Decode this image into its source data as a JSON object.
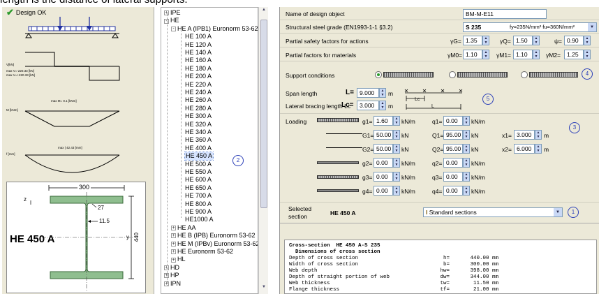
{
  "top_text": "length is the distance of lateral supports.",
  "left": {
    "status": "Design OK",
    "shear_labels": [
      "V[kN]",
      "max V=-220.33 [kN]",
      "max V=+220.33 [kN]"
    ],
    "moment_label": "max M= 0.1 [kNm]",
    "moment2_label": "M [kNm]",
    "deflection_label": "max | 42.43 [mm]",
    "deflection_axis": "f [mm]",
    "section": {
      "name": "HE 450 A",
      "width": "300",
      "height": "440",
      "flange": "27",
      "web": "11.5",
      "axis_z": "z",
      "axis_y": "y"
    }
  },
  "tree": {
    "items": [
      {
        "label": "IPE",
        "level": 0,
        "exp": "+"
      },
      {
        "label": "HE",
        "level": 0,
        "exp": "-"
      },
      {
        "label": "HE A (IPB1) Euronorm 53-62",
        "level": 1,
        "exp": "-"
      },
      {
        "label": "HE 100 A",
        "level": 2
      },
      {
        "label": "HE 120 A",
        "level": 2
      },
      {
        "label": "HE 140 A",
        "level": 2
      },
      {
        "label": "HE 160 A",
        "level": 2
      },
      {
        "label": "HE 180 A",
        "level": 2
      },
      {
        "label": "HE 200 A",
        "level": 2
      },
      {
        "label": "HE 220 A",
        "level": 2
      },
      {
        "label": "HE 240 A",
        "level": 2
      },
      {
        "label": "HE 260 A",
        "level": 2
      },
      {
        "label": "HE 280 A",
        "level": 2
      },
      {
        "label": "HE 300 A",
        "level": 2
      },
      {
        "label": "HE 320 A",
        "level": 2
      },
      {
        "label": "HE 340 A",
        "level": 2
      },
      {
        "label": "HE 360 A",
        "level": 2
      },
      {
        "label": "HE 400 A",
        "level": 2
      },
      {
        "label": "HE 450 A",
        "level": 2,
        "selected": true
      },
      {
        "label": "HE 500 A",
        "level": 2
      },
      {
        "label": "HE 550 A",
        "level": 2
      },
      {
        "label": "HE 600 A",
        "level": 2
      },
      {
        "label": "HE 650 A",
        "level": 2
      },
      {
        "label": "HE 700 A",
        "level": 2
      },
      {
        "label": "HE 800 A",
        "level": 2
      },
      {
        "label": "HE 900 A",
        "level": 2
      },
      {
        "label": "HE1000 A",
        "level": 2
      },
      {
        "label": "HE AA",
        "level": 1,
        "exp": "+"
      },
      {
        "label": "HE B (IPB) Euronorm 53-62",
        "level": 1,
        "exp": "+"
      },
      {
        "label": "HE M (IPBv) Euronorm 53-62",
        "level": 1,
        "exp": "+"
      },
      {
        "label": "HE Euronorm 53-62",
        "level": 1,
        "exp": "+"
      },
      {
        "label": "HL",
        "level": 1,
        "exp": "+"
      },
      {
        "label": "HD",
        "level": 0,
        "exp": "+"
      },
      {
        "label": "HP",
        "level": 0,
        "exp": "+"
      },
      {
        "label": "IPN",
        "level": 0,
        "exp": "+"
      }
    ],
    "callout": "2"
  },
  "form": {
    "name_label": "Name of design object",
    "name_value": "BM-M-E11",
    "grade_label": "Structural steel grade (EN1993-1-1 §3.2)",
    "grade_value": "S 235",
    "grade_props": "fy=235N/mm² fu=360N/mm²",
    "psf_actions_label": "Partial safety factors for actions",
    "gG_label": "γG=",
    "gG": "1.35",
    "gQ_label": "γQ=",
    "gQ": "1.50",
    "psi_label": "ψ=",
    "psi": "0.90",
    "psf_materials_label": "Partial factors for materials",
    "gM0_label": "γM0=",
    "gM0": "1.10",
    "gM1_label": "γM1=",
    "gM1": "1.10",
    "gM2_label": "γM2=",
    "gM2": "1.25",
    "support_label": "Support conditions",
    "callout_support": "4",
    "span_label": "Span length",
    "L_label": "L=",
    "L": "9.000",
    "L_unit": "m",
    "lb_label": "Lateral bracing length Lc",
    "Lc_label": "Lc=",
    "Lc": "3.000",
    "Lc_unit": "m",
    "span_diagram_lc": "Lc",
    "span_diagram_l": "L",
    "callout_span": "5",
    "loading_label": "Loading",
    "callout_loading": "3",
    "loads": {
      "g1_label": "g1=",
      "g1": "1.60",
      "g1_unit": "kN/m",
      "q1_label": "q1=",
      "q1": "0.00",
      "q1_unit": "kN/m",
      "G1_label": "G1=",
      "G1": "50.00",
      "G1_unit": "kN",
      "Q1_label": "Q1=",
      "Q1": "95.00",
      "Q1_unit": "kN",
      "x1_label": "x1=",
      "x1": "3.000",
      "x1_unit": "m",
      "G2_label": "G2=",
      "G2": "50.00",
      "G2_unit": "kN",
      "Q2_label": "Q2=",
      "Q2": "95.00",
      "Q2_unit": "kN",
      "x2_label": "x2=",
      "x2": "6.000",
      "x2_unit": "m",
      "g2_label": "g2=",
      "g2": "0.00",
      "g2_unit": "kN/m",
      "q2_label": "q2=",
      "q2": "0.00",
      "q2_unit": "kN/m",
      "g3_label": "g3=",
      "g3": "0.00",
      "g3_unit": "kN/m",
      "q3_label": "q3=",
      "q3": "0.00",
      "q3_unit": "kN/m",
      "g4_label": "g4=",
      "g4": "0.00",
      "g4_unit": "kN/m",
      "q4_label": "q4=",
      "q4": "0.00",
      "q4_unit": "kN/m"
    },
    "selected_label_1": "Selected",
    "selected_label_2": "section",
    "selected_value": "HE 450 A",
    "sections_combo": "Standard sections",
    "callout_section": "1"
  },
  "report": {
    "title": "Cross-section  HE 450 A-S 235",
    "subtitle": "  Dimensions of cross section",
    "rows": [
      {
        "label": "Depth of cross section",
        "sym": "h=",
        "val": "440.00 mm"
      },
      {
        "label": "Width of cross section",
        "sym": "b=",
        "val": "300.00 mm"
      },
      {
        "label": "Web depth",
        "sym": "hw=",
        "val": "398.00 mm"
      },
      {
        "label": "Depth of straight portion of web",
        "sym": "dw=",
        "val": "344.00 mm"
      },
      {
        "label": "Web thickness",
        "sym": "tw=",
        "val": "11.50 mm"
      },
      {
        "label": "Flange thickness",
        "sym": "tf=",
        "val": "21.00 mm"
      }
    ]
  }
}
